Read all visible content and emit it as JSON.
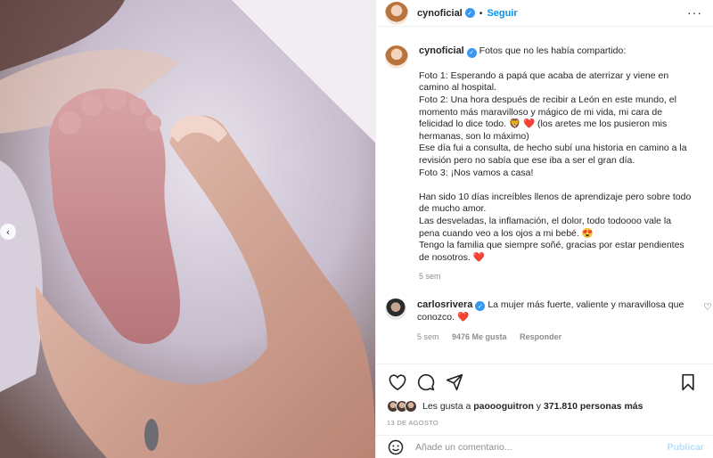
{
  "post": {
    "username": "cynoficial",
    "follow_label": "Seguir",
    "more_icon": "more-horizontal-icon",
    "caption": {
      "intro": "Fotos que no les había compartido:",
      "lines1": [
        "Foto 1: Esperando a papá que acaba de aterrizar y viene en",
        "camino al hospital.",
        "Foto 2: Una hora después de recibir a León en este mundo, el",
        "momento más maravilloso y mágico de mi vida, mi cara de",
        "felicidad lo dice todo. 🦁 ❤️  (los aretes me los pusieron mis",
        "hermanas, son lo máximo)",
        "Ese día fui a consulta, de hecho subí una historia en camino a la",
        "revisión pero no sabía que ese iba a ser el gran día.",
        "Foto 3: ¡Nos vamos a casa!"
      ],
      "lines2": [
        "Han sido 10 días increíbles llenos de aprendizaje pero sobre todo",
        "de mucho amor.",
        "Las desveladas, la inflamación, el dolor, todo todoooo vale la",
        "pena cuando veo a los ojos a mi bebé. 😍",
        "Tengo la familia que siempre soñé, gracias por estar pendientes",
        "de nosotros. ❤️"
      ],
      "time": "5 sem"
    },
    "comment": {
      "username": "carlosrivera",
      "line1": "La mujer más fuerte, valiente y maravillosa que",
      "line2": "conozco. ❤️",
      "time": "5 sem",
      "likes": "9476 Me gusta",
      "reply_label": "Responder"
    },
    "likes_prefix": "Les gusta a ",
    "likes_user": "paoooguitron",
    "likes_middle": " y ",
    "likes_count": "371.810 personas más",
    "date": "13 DE AGOSTO",
    "add_comment_placeholder": "Añade un comentario...",
    "publish_label": "Publicar",
    "carousel_prev": "‹"
  }
}
